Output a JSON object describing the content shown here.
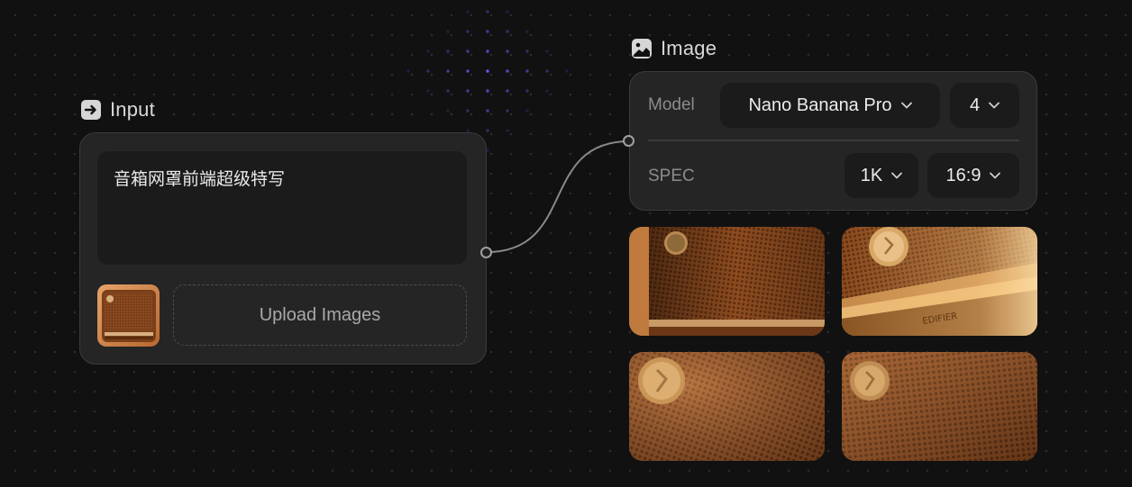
{
  "input_node": {
    "title": "Input",
    "icon": "arrow-right-box-icon",
    "prompt_text": "音箱网罩前端超级特写",
    "upload_label": "Upload Images"
  },
  "image_node": {
    "title": "Image",
    "icon": "image-icon",
    "model_label": "Model",
    "model_value": "Nano Banana Pro",
    "count_value": "4",
    "spec_label": "SPEC",
    "resolution_value": "1K",
    "aspect_value": "16:9",
    "results": [
      {
        "name": "result-image-1"
      },
      {
        "name": "result-image-2",
        "engraving": "EDIFIER"
      },
      {
        "name": "result-image-3"
      },
      {
        "name": "result-image-4"
      }
    ]
  },
  "colors": {
    "background": "#111112",
    "card": "#252526",
    "field": "#1b1b1c",
    "accent_dots": "#6a55e8",
    "wood": "#9a5424"
  }
}
